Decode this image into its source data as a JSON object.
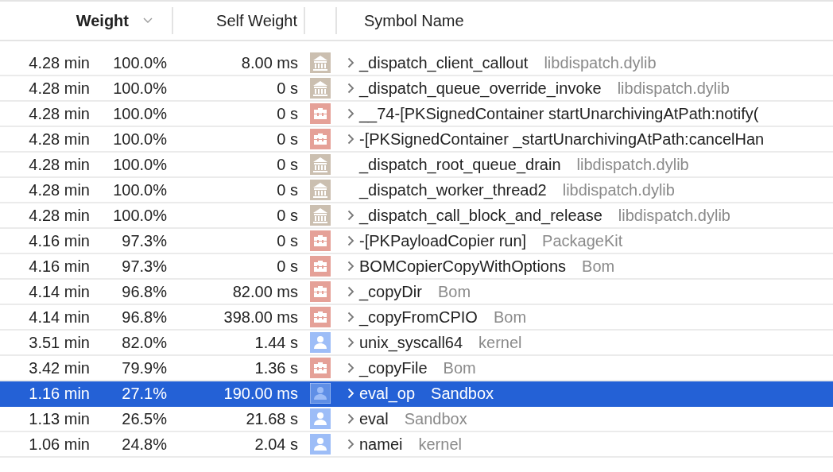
{
  "columns": [
    {
      "label": "Weight",
      "sorted": true
    },
    {
      "label": "Self Weight",
      "sorted": false
    },
    {
      "label": "Symbol Name",
      "sorted": false
    }
  ],
  "rows": [
    {
      "time": "4.28 min",
      "percent": "100.0%",
      "self": "8.00 ms",
      "kind": "library",
      "expandable": true,
      "symbol": "_dispatch_client_callout",
      "library": "libdispatch.dylib",
      "selected": false
    },
    {
      "time": "4.28 min",
      "percent": "100.0%",
      "self": "0 s",
      "kind": "library",
      "expandable": true,
      "symbol": "_dispatch_queue_override_invoke",
      "library": "libdispatch.dylib",
      "selected": false
    },
    {
      "time": "4.28 min",
      "percent": "100.0%",
      "self": "0 s",
      "kind": "framework",
      "expandable": true,
      "symbol": "__74-[PKSignedContainer startUnarchivingAtPath:notify(",
      "selected": false
    },
    {
      "time": "4.28 min",
      "percent": "100.0%",
      "self": "0 s",
      "kind": "framework",
      "expandable": true,
      "symbol": "-[PKSignedContainer _startUnarchivingAtPath:cancelHan",
      "selected": false
    },
    {
      "time": "4.28 min",
      "percent": "100.0%",
      "self": "0 s",
      "kind": "library",
      "expandable": false,
      "symbol": "_dispatch_root_queue_drain",
      "library": "libdispatch.dylib",
      "selected": false
    },
    {
      "time": "4.28 min",
      "percent": "100.0%",
      "self": "0 s",
      "kind": "library",
      "expandable": false,
      "symbol": "_dispatch_worker_thread2",
      "library": "libdispatch.dylib",
      "selected": false
    },
    {
      "time": "4.28 min",
      "percent": "100.0%",
      "self": "0 s",
      "kind": "library",
      "expandable": true,
      "symbol": "_dispatch_call_block_and_release",
      "library": "libdispatch.dylib",
      "selected": false
    },
    {
      "time": "4.16 min",
      "percent": "97.3%",
      "self": "0 s",
      "kind": "framework",
      "expandable": true,
      "symbol": "-[PKPayloadCopier run]",
      "library": "PackageKit",
      "selected": false
    },
    {
      "time": "4.16 min",
      "percent": "97.3%",
      "self": "0 s",
      "kind": "framework",
      "expandable": true,
      "symbol": "BOMCopierCopyWithOptions",
      "library": "Bom",
      "selected": false
    },
    {
      "time": "4.14 min",
      "percent": "96.8%",
      "self": "82.00 ms",
      "kind": "framework",
      "expandable": true,
      "symbol": "_copyDir",
      "library": "Bom",
      "selected": false
    },
    {
      "time": "4.14 min",
      "percent": "96.8%",
      "self": "398.00 ms",
      "kind": "framework",
      "expandable": true,
      "symbol": "_copyFromCPIO",
      "library": "Bom",
      "selected": false
    },
    {
      "time": "3.51 min",
      "percent": "82.0%",
      "self": "1.44 s",
      "kind": "user",
      "expandable": true,
      "symbol": "unix_syscall64",
      "library": "kernel",
      "selected": false
    },
    {
      "time": "3.42 min",
      "percent": "79.9%",
      "self": "1.36 s",
      "kind": "framework",
      "expandable": true,
      "symbol": "_copyFile",
      "library": "Bom",
      "selected": false
    },
    {
      "time": "1.16 min",
      "percent": "27.1%",
      "self": "190.00 ms",
      "kind": "user",
      "expandable": true,
      "symbol": "eval_op",
      "library": "Sandbox",
      "selected": true
    },
    {
      "time": "1.13 min",
      "percent": "26.5%",
      "self": "21.68 s",
      "kind": "user",
      "expandable": true,
      "symbol": "eval",
      "library": "Sandbox",
      "selected": false
    },
    {
      "time": "1.06 min",
      "percent": "24.8%",
      "self": "2.04 s",
      "kind": "user",
      "expandable": true,
      "symbol": "namei",
      "library": "kernel",
      "selected": false
    }
  ]
}
